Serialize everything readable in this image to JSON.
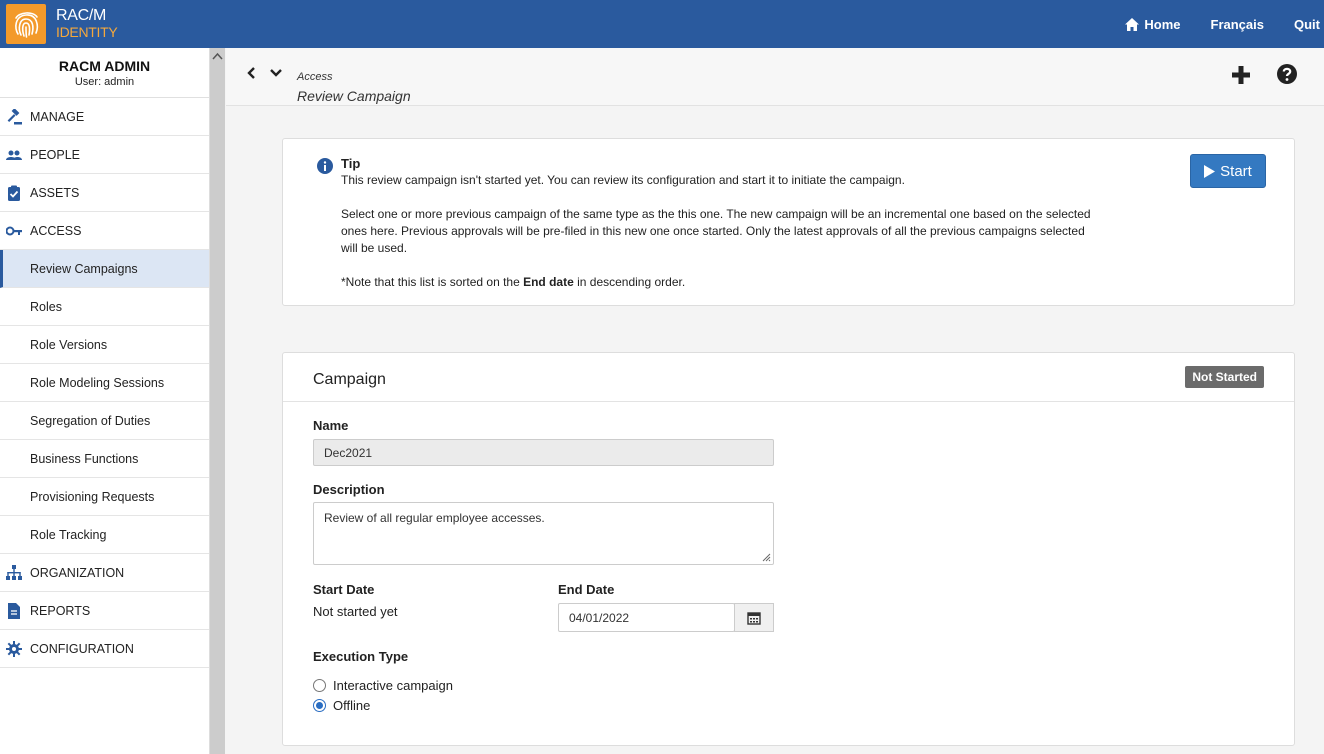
{
  "brand": {
    "line1": "RAC/M",
    "line2": "IDENTITY",
    "mark_color": "#f39a2b"
  },
  "topnav": {
    "home": "Home",
    "lang": "Français",
    "quit": "Quit"
  },
  "user": {
    "name": "RACM ADMIN",
    "sub": "User: admin"
  },
  "sidebar": {
    "items": [
      {
        "label": "MANAGE",
        "icon": "gavel-icon"
      },
      {
        "label": "PEOPLE",
        "icon": "people-icon"
      },
      {
        "label": "ASSETS",
        "icon": "clipboard-check-icon"
      },
      {
        "label": "ACCESS",
        "icon": "key-icon"
      },
      {
        "label": "Review Campaigns"
      },
      {
        "label": "Roles"
      },
      {
        "label": "Role Versions"
      },
      {
        "label": "Role Modeling Sessions"
      },
      {
        "label": "Segregation of Duties"
      },
      {
        "label": "Business Functions"
      },
      {
        "label": "Provisioning Requests"
      },
      {
        "label": "Role Tracking"
      },
      {
        "label": "ORGANIZATION",
        "icon": "org-chart-icon"
      },
      {
        "label": "REPORTS",
        "icon": "document-icon"
      },
      {
        "label": "CONFIGURATION",
        "icon": "gear-icon"
      }
    ]
  },
  "breadcrumb": {
    "parent": "Access",
    "current": "Review Campaign"
  },
  "tip": {
    "title": "Tip",
    "p1": "This review campaign isn't started yet. You can review its configuration and start it to initiate the campaign.",
    "p2": "Select one or more previous campaign of the same type as the this one. The new campaign will be an incremental one based on the selected ones here. Previous approvals will be pre-filed in this new one once started. Only the latest approvals of all the previous campaigns selected will be used.",
    "note_prefix": "*Note that this list is sorted on the ",
    "note_bold": "End date",
    "note_suffix": " in descending order.",
    "start_label": "Start"
  },
  "campaign": {
    "title": "Campaign",
    "status": "Not Started",
    "name_label": "Name",
    "name_value": "Dec2021",
    "desc_label": "Description",
    "desc_value": "Review of all regular employee accesses.",
    "start_label": "Start Date",
    "start_value": "Not started yet",
    "end_label": "End Date",
    "end_value": "04/01/2022",
    "exec_label": "Execution Type",
    "exec_options": [
      "Interactive campaign",
      "Offline"
    ],
    "exec_selected": "Offline"
  },
  "colors": {
    "topbar": "#2a5a9e",
    "accent": "#3479c1",
    "badge": "#6b6b6b"
  }
}
